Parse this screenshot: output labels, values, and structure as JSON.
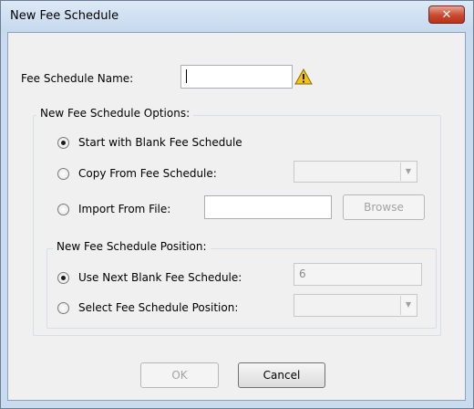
{
  "window": {
    "title": "New Fee Schedule",
    "close_glyph": "✕"
  },
  "name_field": {
    "label": "Fee Schedule Name:",
    "value": "",
    "warning_icon": "warning-triangle-icon"
  },
  "options_group": {
    "legend": "New Fee Schedule Options:",
    "blank_label": "Start with Blank Fee Schedule",
    "blank_checked": true,
    "copy_label": "Copy From Fee Schedule:",
    "copy_checked": false,
    "copy_value": "",
    "import_label": "Import From File:",
    "import_checked": false,
    "import_value": "",
    "browse_label": "Browse"
  },
  "position_group": {
    "legend": "New Fee Schedule Position:",
    "next_label": "Use Next Blank Fee Schedule:",
    "next_checked": true,
    "next_value": "6",
    "select_label": "Select Fee Schedule Position:",
    "select_checked": false,
    "select_value": ""
  },
  "buttons": {
    "ok_label": "OK",
    "cancel_label": "Cancel"
  }
}
